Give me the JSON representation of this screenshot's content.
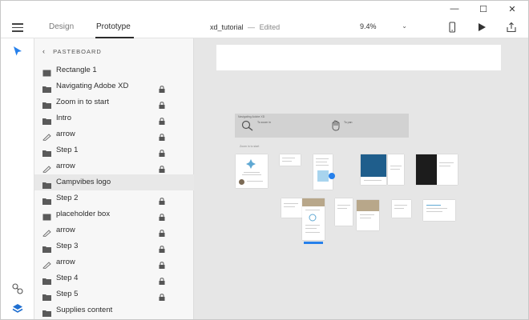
{
  "window": {
    "minimize_glyph": "—",
    "maximize_glyph": "☐",
    "close_glyph": "✕"
  },
  "toolbar": {
    "tabs": [
      {
        "label": "Design",
        "active": false
      },
      {
        "label": "Prototype",
        "active": true
      }
    ],
    "document_name": "xd_tutorial",
    "separator": "—",
    "status": "Edited",
    "zoom": "9.4%",
    "icons": [
      "hamburger-menu-icon",
      "mobile-preview-icon",
      "play-icon",
      "share-icon"
    ]
  },
  "rail": {
    "icons": [
      "select-arrow-icon",
      "link-icon",
      "layers-icon"
    ],
    "accent_color": "#2680eb"
  },
  "layers": {
    "header": "PASTEBOARD",
    "items": [
      {
        "label": "Rectangle 1",
        "icon": "rectangle-icon",
        "locked": false,
        "selected": false
      },
      {
        "label": "Navigating Adobe XD",
        "icon": "folder-icon",
        "locked": true,
        "selected": false
      },
      {
        "label": "Zoom in to start",
        "icon": "folder-icon",
        "locked": true,
        "selected": false
      },
      {
        "label": "Intro",
        "icon": "folder-icon",
        "locked": true,
        "selected": false
      },
      {
        "label": "arrow",
        "icon": "pen-path-icon",
        "locked": true,
        "selected": false
      },
      {
        "label": "Step 1",
        "icon": "folder-icon",
        "locked": true,
        "selected": false
      },
      {
        "label": "arrow",
        "icon": "pen-path-icon",
        "locked": true,
        "selected": false
      },
      {
        "label": "Campvibes logo",
        "icon": "folder-icon",
        "locked": false,
        "selected": true
      },
      {
        "label": "Step 2",
        "icon": "folder-icon",
        "locked": true,
        "selected": false
      },
      {
        "label": "placeholder box",
        "icon": "rectangle-icon",
        "locked": true,
        "selected": false
      },
      {
        "label": "arrow",
        "icon": "pen-path-icon",
        "locked": true,
        "selected": false
      },
      {
        "label": "Step 3",
        "icon": "folder-icon",
        "locked": true,
        "selected": false
      },
      {
        "label": "arrow",
        "icon": "pen-path-icon",
        "locked": true,
        "selected": false
      },
      {
        "label": "Step 4",
        "icon": "folder-icon",
        "locked": true,
        "selected": false
      },
      {
        "label": "Step 5",
        "icon": "folder-icon",
        "locked": true,
        "selected": false
      },
      {
        "label": "Supplies content",
        "icon": "folder-icon",
        "locked": false,
        "selected": false
      }
    ]
  },
  "canvas": {
    "nav_board_title": "Navigating Adobe XD",
    "nav_text_a": "To zoom in",
    "nav_text_b": "To pan",
    "start_label": "Zoom in to start"
  }
}
